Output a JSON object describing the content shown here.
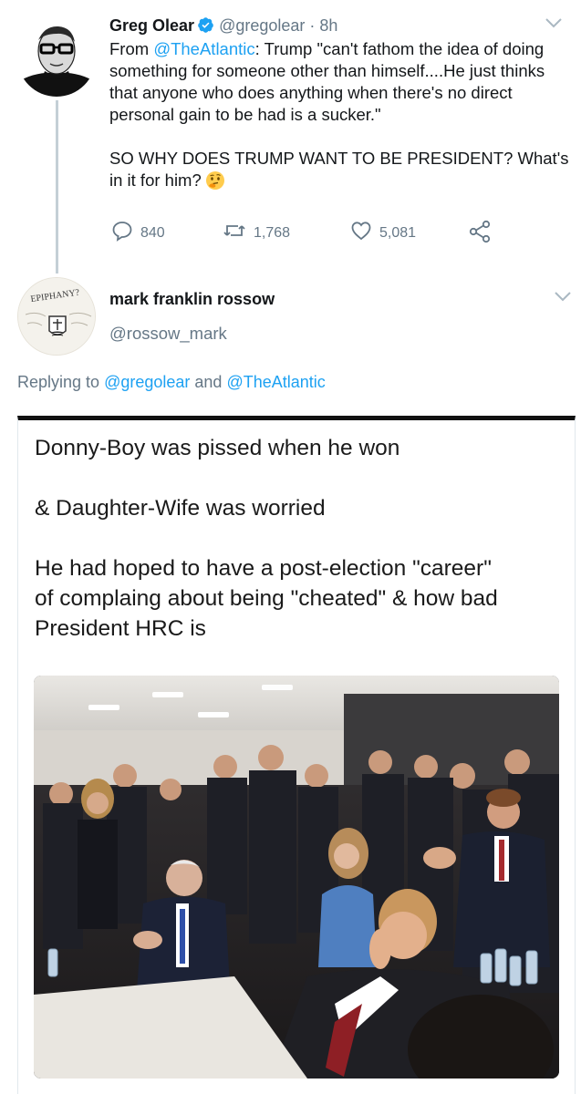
{
  "tweet": {
    "author_name": "Greg Olear",
    "author_handle": "@gregolear",
    "separator": "·",
    "time": "8h",
    "body_line1_prefix": "From ",
    "body_mention": "@TheAtlantic",
    "body_line1_rest": ": Trump \"can't fathom the idea of doing something for someone other than himself....He just thinks that anyone who does anything when there's no direct personal gain to be had is a sucker.\"",
    "body_line2": "SO WHY DOES TRUMP WANT TO BE PRESIDENT? What's in it for him?",
    "emoji": "thinking-face",
    "reply_count": "840",
    "retweet_count": "1,768",
    "like_count": "5,081",
    "accent_color": "#1da1f2"
  },
  "reply": {
    "author_name": "mark franklin rossow",
    "author_handle": "@rossow_mark",
    "avatar_text": "EPIPHANY?",
    "replying_prefix": "Replying to ",
    "replying_mention1": "@gregolear",
    "replying_and": " and ",
    "replying_mention2": "@TheAtlantic",
    "image": {
      "line1": "Donny-Boy was pissed when he won",
      "line2": "& Daughter-Wife was worried",
      "line3a": "He had hoped to have a post-election \"career\"",
      "line3b": "of complaing about being \"cheated\" & how bad",
      "line3c": "President HRC is"
    }
  }
}
